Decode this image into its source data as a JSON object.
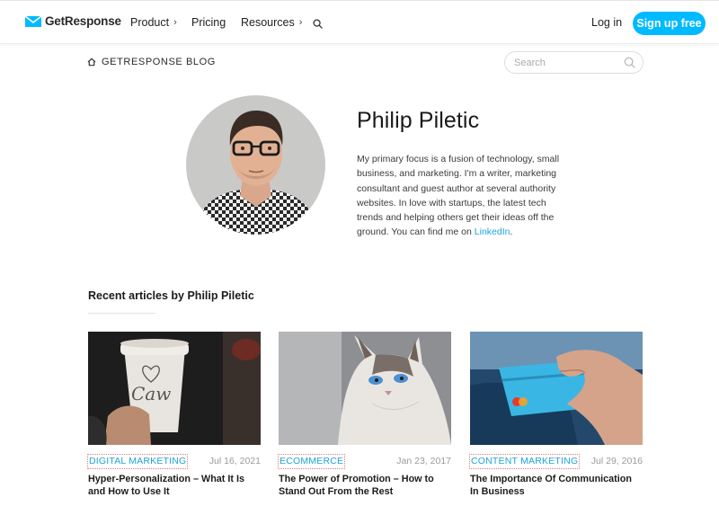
{
  "header": {
    "logo_text": "GetResponse",
    "nav": [
      {
        "label": "Product",
        "has_chevron": true
      },
      {
        "label": "Pricing",
        "has_chevron": false
      },
      {
        "label": "Resources",
        "has_chevron": true
      }
    ],
    "search_icon": "search-icon",
    "login_label": "Log in",
    "signup_label": "Sign up free"
  },
  "blog_bar": {
    "home_icon": "home-icon",
    "label": "GETRESPONSE BLOG",
    "search_placeholder": "Search"
  },
  "author": {
    "name": "Philip Piletic",
    "bio": "My primary focus is a fusion of technology, small business, and marketing. I'm a writer, marketing consultant and guest author at several authority websites. In love with startups, the latest tech trends and helping others get their ideas off the ground. You can find me on ",
    "bio_link": "LinkedIn",
    "bio_end": "."
  },
  "recent": {
    "title": "Recent articles by Philip Piletic",
    "articles": [
      {
        "category": "DIGITAL MARKETING",
        "date": "Jul 16, 2021",
        "title": "Hyper-Personalization – What It Is and How to Use It"
      },
      {
        "category": "ECOMMERCE",
        "date": "Jan 23, 2017",
        "title": "The Power of Promotion – How to Stand Out From the Rest"
      },
      {
        "category": "CONTENT MARKETING",
        "date": "Jul 29, 2016",
        "title": "The Importance Of Communication In Business"
      }
    ]
  },
  "colors": {
    "accent": "#00baff",
    "link": "#1fa4d8",
    "text": "#1c1c1c",
    "muted": "#9a9a9a"
  }
}
